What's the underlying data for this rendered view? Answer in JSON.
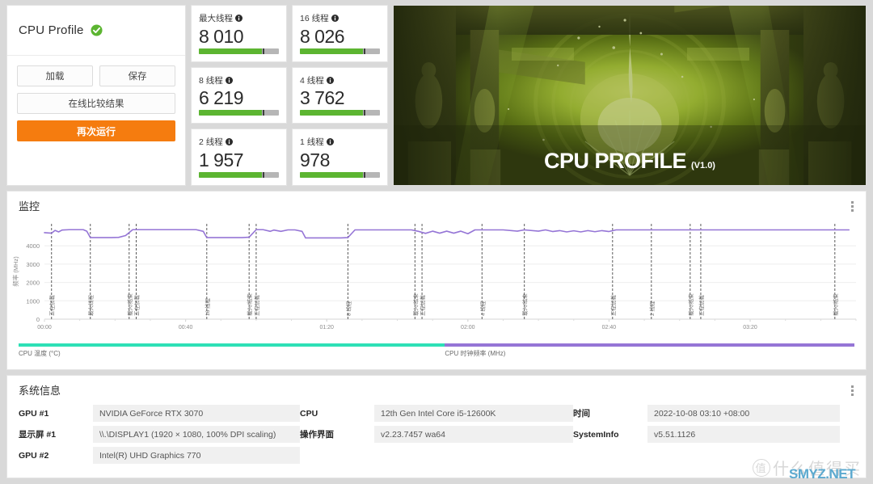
{
  "result": {
    "title": "CPU Profile",
    "status_icon": "green-check-icon",
    "load_label": "加载",
    "save_label": "保存",
    "compare_label": "在线比较结果",
    "rerun_label": "再次运行"
  },
  "scores": [
    {
      "label": "最大线程",
      "value": "8 010",
      "fill_pct": 79,
      "mark_pct": 80
    },
    {
      "label": "16 线程",
      "value": "8 026",
      "fill_pct": 79,
      "mark_pct": 80
    },
    {
      "label": "8 线程",
      "value": "6 219",
      "fill_pct": 79,
      "mark_pct": 80
    },
    {
      "label": "4 线程",
      "value": "3 762",
      "fill_pct": 79,
      "mark_pct": 80
    },
    {
      "label": "2 线程",
      "value": "1 957",
      "fill_pct": 79,
      "mark_pct": 80
    },
    {
      "label": "1 线程",
      "value": "978",
      "fill_pct": 79,
      "mark_pct": 80
    }
  ],
  "banner": {
    "title": "CPU PROFILE",
    "version": "(V1.0)"
  },
  "monitor": {
    "title": "监控",
    "menu_icon": "kebab-menu-icon",
    "legend": [
      {
        "name": "CPU 温度 (°C)",
        "color": "#2ee0b6"
      },
      {
        "name": "CPU 时钟频率 (MHz)",
        "color": "#9575d6"
      }
    ]
  },
  "chart_data": {
    "type": "line",
    "title": "监控",
    "xlabel": "",
    "ylabel": "频率 (MHz)",
    "ylim": [
      0,
      5200
    ],
    "yticks": [
      0,
      1000,
      2000,
      3000,
      4000
    ],
    "xlim": [
      0,
      230
    ],
    "xticks": [
      0,
      40,
      80,
      120,
      160,
      200
    ],
    "xticklabels": [
      "00:00",
      "00:40",
      "01:20",
      "02:00",
      "02:40",
      "03:20"
    ],
    "grid": true,
    "legend_position": "bottom",
    "series": [
      {
        "name": "CPU 时钟频率 (MHz)",
        "color": "#9575d6",
        "unit": "MHz",
        "points": [
          [
            0,
            4720
          ],
          [
            2,
            4690
          ],
          [
            3,
            4840
          ],
          [
            4,
            4760
          ],
          [
            5,
            4860
          ],
          [
            7,
            4880
          ],
          [
            11,
            4880
          ],
          [
            12,
            4800
          ],
          [
            13,
            4450
          ],
          [
            19,
            4450
          ],
          [
            21,
            4460
          ],
          [
            23,
            4560
          ],
          [
            25,
            4880
          ],
          [
            27,
            4880
          ],
          [
            29,
            4880
          ],
          [
            31,
            4880
          ],
          [
            43,
            4880
          ],
          [
            45,
            4790
          ],
          [
            46,
            4450
          ],
          [
            56,
            4450
          ],
          [
            58,
            4470
          ],
          [
            60,
            4880
          ],
          [
            62,
            4880
          ],
          [
            64,
            4790
          ],
          [
            65,
            4860
          ],
          [
            67,
            4790
          ],
          [
            69,
            4870
          ],
          [
            71,
            4870
          ],
          [
            73,
            4790
          ],
          [
            74,
            4430
          ],
          [
            84,
            4430
          ],
          [
            86,
            4450
          ],
          [
            88,
            4870
          ],
          [
            92,
            4870
          ],
          [
            96,
            4870
          ],
          [
            104,
            4870
          ],
          [
            106,
            4790
          ],
          [
            108,
            4680
          ],
          [
            110,
            4800
          ],
          [
            112,
            4690
          ],
          [
            114,
            4800
          ],
          [
            116,
            4690
          ],
          [
            118,
            4800
          ],
          [
            120,
            4660
          ],
          [
            122,
            4870
          ],
          [
            126,
            4870
          ],
          [
            130,
            4870
          ],
          [
            134,
            4800
          ],
          [
            136,
            4870
          ],
          [
            140,
            4800
          ],
          [
            142,
            4870
          ],
          [
            144,
            4780
          ],
          [
            146,
            4830
          ],
          [
            148,
            4760
          ],
          [
            150,
            4820
          ],
          [
            152,
            4760
          ],
          [
            154,
            4830
          ],
          [
            156,
            4770
          ],
          [
            158,
            4830
          ],
          [
            160,
            4780
          ],
          [
            162,
            4870
          ],
          [
            166,
            4870
          ],
          [
            170,
            4870
          ],
          [
            180,
            4870
          ],
          [
            200,
            4870
          ],
          [
            215,
            4870
          ],
          [
            222,
            4870
          ],
          [
            228,
            4870
          ]
        ]
      }
    ],
    "event_markers": [
      {
        "x": 2,
        "label": "正在加载"
      },
      {
        "x": 13,
        "label": "最大线程"
      },
      {
        "x": 24,
        "label": "载入/结束"
      },
      {
        "x": 26,
        "label": "正在加载"
      },
      {
        "x": 46,
        "label": "16 线程"
      },
      {
        "x": 58,
        "label": "载入/结束"
      },
      {
        "x": 60,
        "label": "正在加载"
      },
      {
        "x": 86,
        "label": "8 线程"
      },
      {
        "x": 105,
        "label": "载入/结束"
      },
      {
        "x": 107,
        "label": "正在加载"
      },
      {
        "x": 124,
        "label": "4 线程"
      },
      {
        "x": 136,
        "label": "载入/结束"
      },
      {
        "x": 161,
        "label": "正在加载"
      },
      {
        "x": 172,
        "label": "2 线程"
      },
      {
        "x": 183,
        "label": "载入/结束"
      },
      {
        "x": 186,
        "label": "正在加载"
      },
      {
        "x": 224,
        "label": "载入/结束"
      }
    ]
  },
  "sysinfo": {
    "title": "系统信息",
    "menu_icon": "kebab-menu-icon",
    "columns": [
      [
        {
          "key": "GPU #1",
          "value": "NVIDIA GeForce RTX 3070"
        },
        {
          "key": "显示屏 #1",
          "value": "\\\\.\\DISPLAY1 (1920 × 1080, 100% DPI scaling)"
        },
        {
          "key": "GPU #2",
          "value": "Intel(R) UHD Graphics 770"
        }
      ],
      [
        {
          "key": "CPU",
          "value": "12th Gen Intel Core i5-12600K"
        },
        {
          "key": "操作界面",
          "value": "v2.23.7457 wa64"
        }
      ],
      [
        {
          "key": "时间",
          "value": "2022-10-08 03:10 +08:00"
        },
        {
          "key": "SystemInfo",
          "value": "v5.51.1126"
        }
      ]
    ]
  },
  "watermarks": {
    "zhi_mark": "值",
    "zhi_text": "什么值得买",
    "site": "SMYZ.NET"
  }
}
